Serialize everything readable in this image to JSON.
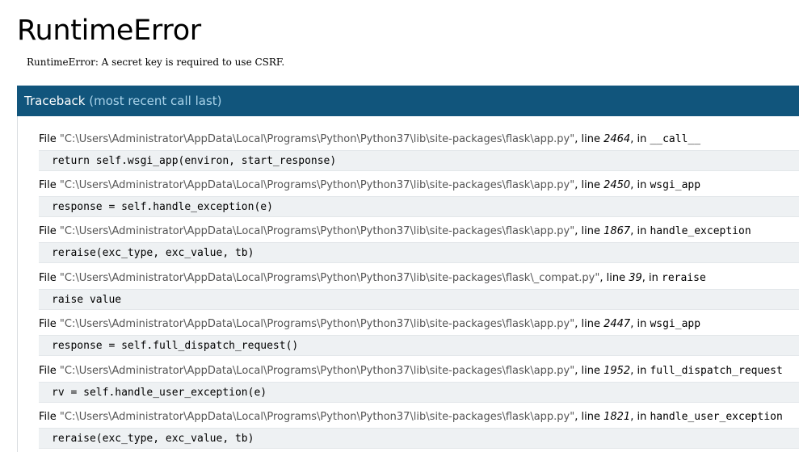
{
  "page": {
    "title": "RuntimeError",
    "error_message": "RuntimeError: A secret key is required to use CSRF."
  },
  "traceback": {
    "header_main": "Traceback",
    "header_sub": "(most recent call last)",
    "file_prefix": "File ",
    "line_prefix": ", line ",
    "in_prefix": ", in ",
    "frames": [
      {
        "path": "\"C:\\Users\\Administrator\\AppData\\Local\\Programs\\Python\\Python37\\lib\\site-packages\\flask\\app.py\"",
        "lineno": "2464",
        "function": "__call__",
        "code": "return self.wsgi_app(environ, start_response)"
      },
      {
        "path": "\"C:\\Users\\Administrator\\AppData\\Local\\Programs\\Python\\Python37\\lib\\site-packages\\flask\\app.py\"",
        "lineno": "2450",
        "function": "wsgi_app",
        "code": "response = self.handle_exception(e)"
      },
      {
        "path": "\"C:\\Users\\Administrator\\AppData\\Local\\Programs\\Python\\Python37\\lib\\site-packages\\flask\\app.py\"",
        "lineno": "1867",
        "function": "handle_exception",
        "code": "reraise(exc_type, exc_value, tb)"
      },
      {
        "path": "\"C:\\Users\\Administrator\\AppData\\Local\\Programs\\Python\\Python37\\lib\\site-packages\\flask\\_compat.py\"",
        "lineno": "39",
        "function": "reraise",
        "code": "raise value"
      },
      {
        "path": "\"C:\\Users\\Administrator\\AppData\\Local\\Programs\\Python\\Python37\\lib\\site-packages\\flask\\app.py\"",
        "lineno": "2447",
        "function": "wsgi_app",
        "code": "response = self.full_dispatch_request()"
      },
      {
        "path": "\"C:\\Users\\Administrator\\AppData\\Local\\Programs\\Python\\Python37\\lib\\site-packages\\flask\\app.py\"",
        "lineno": "1952",
        "function": "full_dispatch_request",
        "code": "rv = self.handle_user_exception(e)"
      },
      {
        "path": "\"C:\\Users\\Administrator\\AppData\\Local\\Programs\\Python\\Python37\\lib\\site-packages\\flask\\app.py\"",
        "lineno": "1821",
        "function": "handle_user_exception",
        "code": "reraise(exc_type, exc_value, tb)"
      }
    ]
  },
  "colors": {
    "header_bg": "#11557c",
    "header_sub": "#a9d3ea",
    "code_bg": "#eef1f3"
  }
}
